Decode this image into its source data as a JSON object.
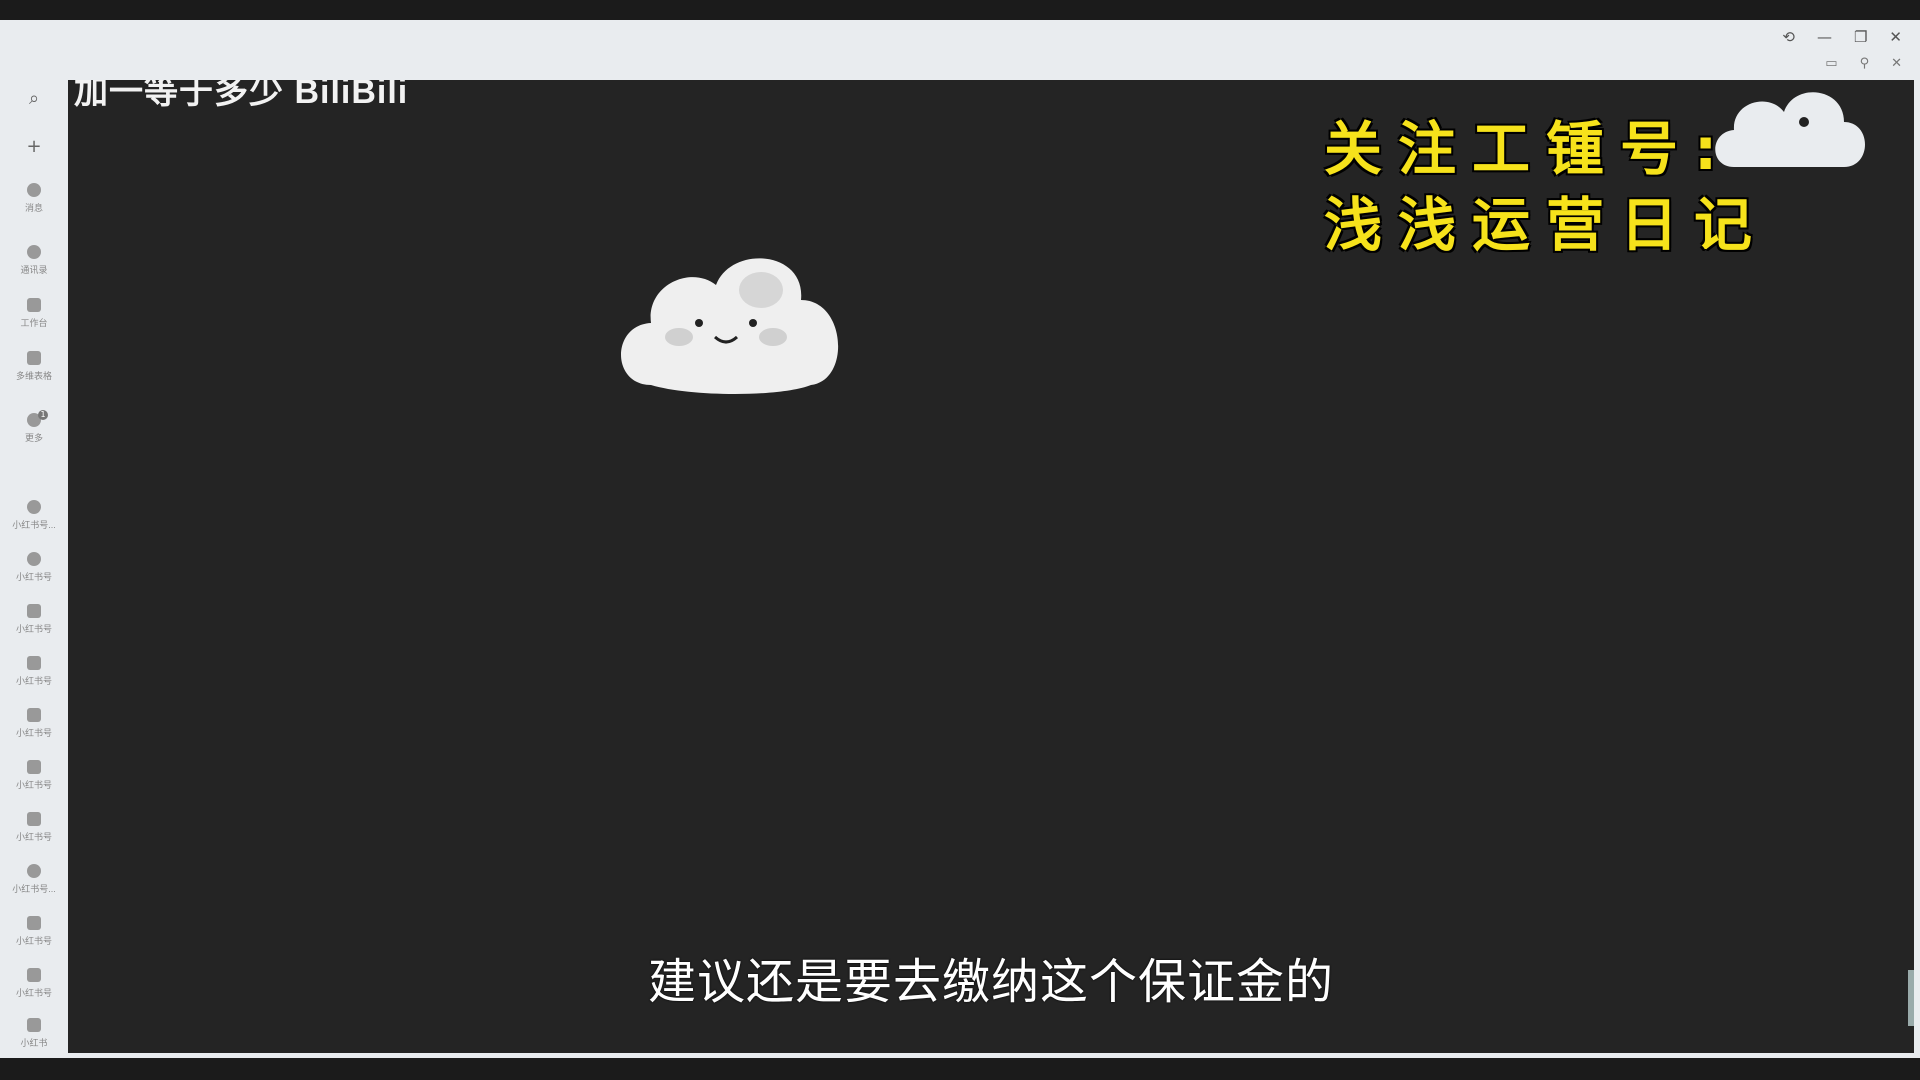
{
  "window": {
    "controls": {
      "history": "⟲",
      "minimize": "—",
      "restore": "❐",
      "close": "✕"
    },
    "secondary": {
      "window": "▭",
      "pin": "⚲",
      "close": "✕"
    }
  },
  "sidebar": {
    "search_icon": "⌕",
    "add_icon": "+",
    "items": [
      {
        "label": "消息",
        "icon": "chat-bubble-icon",
        "badge": ""
      },
      {
        "label": "通讯录",
        "icon": "contacts-icon",
        "badge": ""
      },
      {
        "label": "工作台",
        "icon": "workbench-icon",
        "badge": ""
      },
      {
        "label": "多维表格",
        "icon": "table-icon",
        "badge": ""
      },
      {
        "label": "更多",
        "icon": "more-icon",
        "badge": "1"
      },
      {
        "label": "小红书号...",
        "icon": "app-icon",
        "badge": ""
      },
      {
        "label": "小红书号",
        "icon": "app-icon",
        "badge": ""
      },
      {
        "label": "小红书号",
        "icon": "doc-icon",
        "badge": ""
      },
      {
        "label": "小红书号",
        "icon": "doc-icon",
        "badge": ""
      },
      {
        "label": "小红书号",
        "icon": "doc-icon",
        "badge": ""
      },
      {
        "label": "小红书号",
        "icon": "doc-icon",
        "badge": ""
      },
      {
        "label": "小红书号",
        "icon": "doc-icon",
        "badge": ""
      },
      {
        "label": "小红书号...",
        "icon": "app-icon",
        "badge": ""
      },
      {
        "label": "小红书号",
        "icon": "doc-icon",
        "badge": ""
      },
      {
        "label": "小红书号",
        "icon": "doc-icon",
        "badge": ""
      },
      {
        "label": "小红书",
        "icon": "doc-icon",
        "badge": ""
      }
    ]
  },
  "content": {
    "watermark": "加一等于多少 BiliBili",
    "promo": {
      "line1": "关注工锺号:",
      "line2": "浅浅运营日记"
    },
    "subtitle": "建议还是要去缴纳这个保证金的"
  },
  "colors": {
    "promo_text": "#f6e21b",
    "content_bg": "#242424",
    "sidebar_bg": "#e9ecef"
  }
}
